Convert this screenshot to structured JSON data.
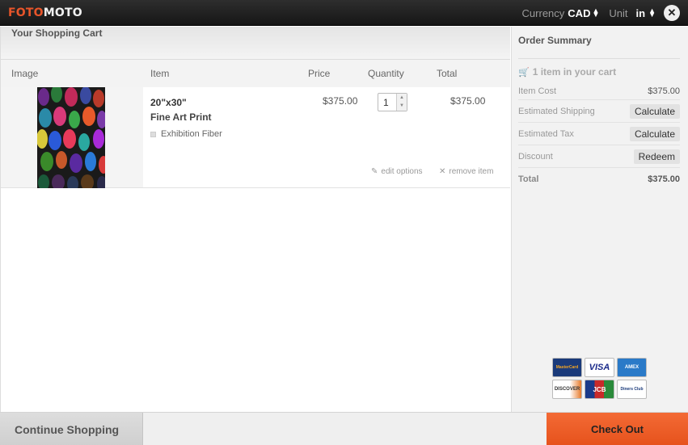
{
  "header": {
    "logo_part1": "FOTO",
    "logo_part2": "MOTO",
    "currency_label": "Currency",
    "currency_value": "CAD",
    "unit_label": "Unit",
    "unit_value": "in",
    "close_glyph": "✕"
  },
  "cart": {
    "title": "Your Shopping Cart",
    "columns": {
      "image": "Image",
      "item": "Item",
      "price": "Price",
      "quantity": "Quantity",
      "total": "Total"
    },
    "items": [
      {
        "size": "20\"x30\"",
        "name": "Fine Art Print",
        "paper": "Exhibition Fiber",
        "price": "$375.00",
        "quantity": "1",
        "total": "$375.00",
        "edit_label": "edit options",
        "remove_label": "remove item"
      }
    ]
  },
  "summary": {
    "title": "Order Summary",
    "count_text": "1 item in your cart",
    "item_cost_label": "Item Cost",
    "item_cost_value": "$375.00",
    "shipping_label": "Estimated Shipping",
    "shipping_button": "Calculate",
    "tax_label": "Estimated Tax",
    "tax_button": "Calculate",
    "discount_label": "Discount",
    "discount_button": "Redeem",
    "total_label": "Total",
    "total_value": "$375.00"
  },
  "payment_cards": [
    "MasterCard",
    "VISA",
    "AMEX",
    "DISCOVER",
    "JCB",
    "Diners Club"
  ],
  "footer": {
    "continue_label": "Continue Shopping",
    "checkout_label": "Check Out"
  },
  "colors": {
    "brand_orange": "#e8552a",
    "checkout_orange": "#f0612b",
    "topbar": "#1e1e1e"
  }
}
